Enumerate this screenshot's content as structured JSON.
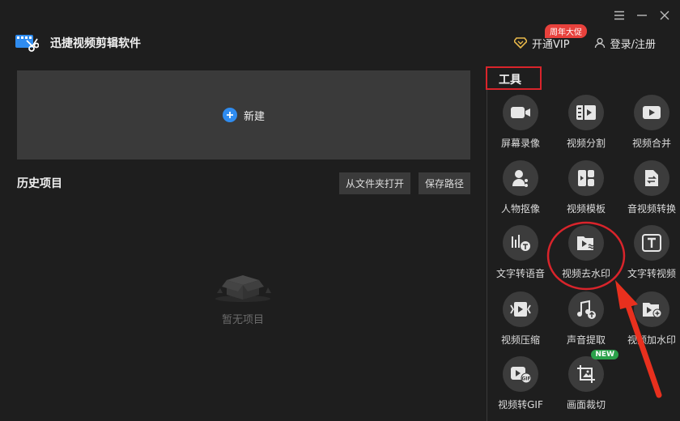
{
  "app": {
    "title": "迅捷视频剪辑软件"
  },
  "header": {
    "vip_label": "开通VIP",
    "vip_badge": "周年大促",
    "login_label": "登录/注册"
  },
  "main": {
    "new_label": "新建",
    "history_title": "历史项目",
    "open_folder_label": "从文件夹打开",
    "save_path_label": "保存路径",
    "empty_label": "暂无项目"
  },
  "tools": {
    "title": "工具",
    "items": [
      {
        "label": "屏幕录像",
        "icon": "screen-record-icon"
      },
      {
        "label": "视频分割",
        "icon": "video-split-icon"
      },
      {
        "label": "视频合并",
        "icon": "video-merge-icon"
      },
      {
        "label": "人物抠像",
        "icon": "person-cutout-icon"
      },
      {
        "label": "视频模板",
        "icon": "video-template-icon"
      },
      {
        "label": "音视频转换",
        "icon": "av-convert-icon"
      },
      {
        "label": "文字转语音",
        "icon": "text-to-speech-icon"
      },
      {
        "label": "视频去水印",
        "icon": "remove-watermark-icon"
      },
      {
        "label": "文字转视频",
        "icon": "text-to-video-icon"
      },
      {
        "label": "视频压缩",
        "icon": "video-compress-icon"
      },
      {
        "label": "声音提取",
        "icon": "audio-extract-icon"
      },
      {
        "label": "视频加水印",
        "icon": "add-watermark-icon"
      },
      {
        "label": "视频转GIF",
        "icon": "video-to-gif-icon"
      },
      {
        "label": "画面裁切",
        "icon": "crop-icon",
        "badge": "NEW"
      }
    ]
  },
  "colors": {
    "accent": "#2f8cf0",
    "highlight_red": "#d9242b",
    "badge_red": "#e8413c",
    "new_green": "#2ba14a"
  }
}
